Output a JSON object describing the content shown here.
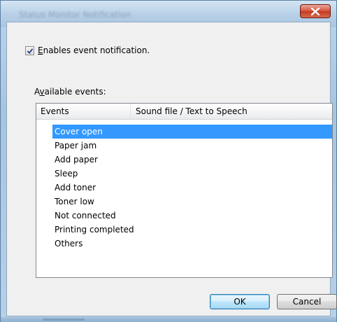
{
  "window": {
    "title": "Status Monitor Notification"
  },
  "notification": {
    "enabled": true,
    "label_mnemonic": "E",
    "label_rest": "nables event notification."
  },
  "available_events": {
    "label_pre": "A",
    "label_mnemonic": "v",
    "label_post": "ailable events:"
  },
  "events_table": {
    "columns": [
      "Events",
      "Sound file / Text to Speech"
    ],
    "selected_index": 0,
    "rows": [
      "Cover open",
      "Paper jam",
      "Add paper",
      "Sleep",
      "Add toner",
      "Toner low",
      "Not connected",
      "Printing completed",
      "Others"
    ]
  },
  "buttons": {
    "ok": "OK",
    "cancel": "Cancel"
  },
  "colors": {
    "selection": "#3399ff",
    "close_button": "#c43a22"
  },
  "icons": {
    "close": "close-icon",
    "checkbox": "checkmark-icon"
  }
}
